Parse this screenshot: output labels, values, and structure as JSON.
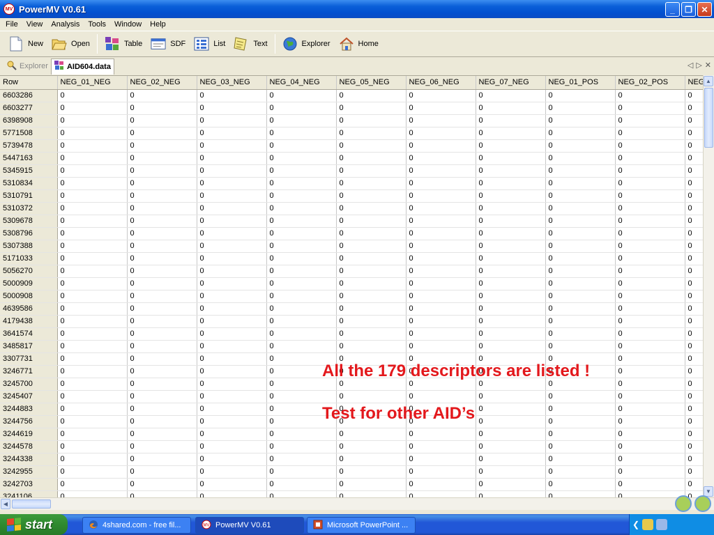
{
  "window": {
    "title": "PowerMV V0.61",
    "icon_label": "MV"
  },
  "menu": [
    "File",
    "View",
    "Analysis",
    "Tools",
    "Window",
    "Help"
  ],
  "toolbar": [
    {
      "label": "New",
      "icon": "new-file-icon"
    },
    {
      "label": "Open",
      "icon": "open-folder-icon"
    },
    {
      "label": "Table",
      "icon": "table-icon"
    },
    {
      "label": "SDF",
      "icon": "sdf-icon"
    },
    {
      "label": "List",
      "icon": "list-icon"
    },
    {
      "label": "Text",
      "icon": "text-icon"
    },
    {
      "label": "Explorer",
      "icon": "globe-icon"
    },
    {
      "label": "Home",
      "icon": "home-icon"
    }
  ],
  "tabs": [
    {
      "label": "Explorer",
      "active": false
    },
    {
      "label": "AID604.data",
      "active": true
    }
  ],
  "grid": {
    "columns": [
      "Row",
      "NEG_01_NEG",
      "NEG_02_NEG",
      "NEG_03_NEG",
      "NEG_04_NEG",
      "NEG_05_NEG",
      "NEG_06_NEG",
      "NEG_07_NEG",
      "NEG_01_POS",
      "NEG_02_POS",
      "NEG_"
    ],
    "rows": [
      {
        "id": "6603286",
        "values": [
          "0",
          "0",
          "0",
          "0",
          "0",
          "0",
          "0",
          "0",
          "0",
          "0"
        ]
      },
      {
        "id": "6603277",
        "values": [
          "0",
          "0",
          "0",
          "0",
          "0",
          "0",
          "0",
          "0",
          "0",
          "0"
        ]
      },
      {
        "id": "6398908",
        "values": [
          "0",
          "0",
          "0",
          "0",
          "0",
          "0",
          "0",
          "0",
          "0",
          "0"
        ]
      },
      {
        "id": "5771508",
        "values": [
          "0",
          "0",
          "0",
          "0",
          "0",
          "0",
          "0",
          "0",
          "0",
          "0"
        ]
      },
      {
        "id": "5739478",
        "values": [
          "0",
          "0",
          "0",
          "0",
          "0",
          "0",
          "0",
          "0",
          "0",
          "0"
        ]
      },
      {
        "id": "5447163",
        "values": [
          "0",
          "0",
          "0",
          "0",
          "0",
          "0",
          "0",
          "0",
          "0",
          "0"
        ]
      },
      {
        "id": "5345915",
        "values": [
          "0",
          "0",
          "0",
          "0",
          "0",
          "0",
          "0",
          "0",
          "0",
          "0"
        ]
      },
      {
        "id": "5310834",
        "values": [
          "0",
          "0",
          "0",
          "0",
          "0",
          "0",
          "0",
          "0",
          "0",
          "0"
        ]
      },
      {
        "id": "5310791",
        "values": [
          "0",
          "0",
          "0",
          "0",
          "0",
          "0",
          "0",
          "0",
          "0",
          "0"
        ]
      },
      {
        "id": "5310372",
        "values": [
          "0",
          "0",
          "0",
          "0",
          "0",
          "0",
          "0",
          "0",
          "0",
          "0"
        ]
      },
      {
        "id": "5309678",
        "values": [
          "0",
          "0",
          "0",
          "0",
          "0",
          "0",
          "0",
          "0",
          "0",
          "0"
        ]
      },
      {
        "id": "5308796",
        "values": [
          "0",
          "0",
          "0",
          "0",
          "0",
          "0",
          "0",
          "0",
          "0",
          "0"
        ]
      },
      {
        "id": "5307388",
        "values": [
          "0",
          "0",
          "0",
          "0",
          "0",
          "0",
          "0",
          "0",
          "0",
          "0"
        ]
      },
      {
        "id": "5171033",
        "values": [
          "0",
          "0",
          "0",
          "0",
          "0",
          "0",
          "0",
          "0",
          "0",
          "0"
        ]
      },
      {
        "id": "5056270",
        "values": [
          "0",
          "0",
          "0",
          "0",
          "0",
          "0",
          "0",
          "0",
          "0",
          "0"
        ]
      },
      {
        "id": "5000909",
        "values": [
          "0",
          "0",
          "0",
          "0",
          "0",
          "0",
          "0",
          "0",
          "0",
          "0"
        ]
      },
      {
        "id": "5000908",
        "values": [
          "0",
          "0",
          "0",
          "0",
          "0",
          "0",
          "0",
          "0",
          "0",
          "0"
        ]
      },
      {
        "id": "4639586",
        "values": [
          "0",
          "0",
          "0",
          "0",
          "0",
          "0",
          "0",
          "0",
          "0",
          "0"
        ]
      },
      {
        "id": "4179438",
        "values": [
          "0",
          "0",
          "0",
          "0",
          "0",
          "0",
          "0",
          "0",
          "0",
          "0"
        ]
      },
      {
        "id": "3641574",
        "values": [
          "0",
          "0",
          "0",
          "0",
          "0",
          "0",
          "0",
          "0",
          "0",
          "0"
        ]
      },
      {
        "id": "3485817",
        "values": [
          "0",
          "0",
          "0",
          "0",
          "0",
          "0",
          "0",
          "0",
          "0",
          "0"
        ]
      },
      {
        "id": "3307731",
        "values": [
          "0",
          "0",
          "0",
          "0",
          "0",
          "0",
          "0",
          "0",
          "0",
          "0"
        ]
      },
      {
        "id": "3246771",
        "values": [
          "0",
          "0",
          "0",
          "0",
          "0",
          "0",
          "0",
          "0",
          "0",
          "0"
        ]
      },
      {
        "id": "3245700",
        "values": [
          "0",
          "0",
          "0",
          "0",
          "0",
          "0",
          "0",
          "0",
          "0",
          "0"
        ]
      },
      {
        "id": "3245407",
        "values": [
          "0",
          "0",
          "0",
          "0",
          "0",
          "0",
          "0",
          "0",
          "0",
          "0"
        ]
      },
      {
        "id": "3244883",
        "values": [
          "0",
          "0",
          "0",
          "0",
          "0",
          "0",
          "0",
          "0",
          "0",
          "0"
        ]
      },
      {
        "id": "3244756",
        "values": [
          "0",
          "0",
          "0",
          "0",
          "0",
          "0",
          "0",
          "0",
          "0",
          "0"
        ]
      },
      {
        "id": "3244619",
        "values": [
          "0",
          "0",
          "0",
          "0",
          "0",
          "0",
          "0",
          "0",
          "0",
          "0"
        ]
      },
      {
        "id": "3244578",
        "values": [
          "0",
          "0",
          "0",
          "0",
          "0",
          "0",
          "0",
          "0",
          "0",
          "0"
        ]
      },
      {
        "id": "3244338",
        "values": [
          "0",
          "0",
          "0",
          "0",
          "0",
          "0",
          "0",
          "0",
          "0",
          "0"
        ]
      },
      {
        "id": "3242955",
        "values": [
          "0",
          "0",
          "0",
          "0",
          "0",
          "0",
          "0",
          "0",
          "0",
          "0"
        ]
      },
      {
        "id": "3242703",
        "values": [
          "0",
          "0",
          "0",
          "0",
          "0",
          "0",
          "0",
          "0",
          "0",
          "0"
        ]
      },
      {
        "id": "3241106",
        "values": [
          "0",
          "0",
          "0",
          "0",
          "0",
          "0",
          "0",
          "0",
          "0",
          "0"
        ]
      }
    ]
  },
  "overlay": {
    "line1": "All the 179 descriptors are listed !",
    "line2": "Test for other AID’s",
    "color": "#e3181c"
  },
  "taskbar": {
    "start_label": "start",
    "tasks": [
      {
        "label": "4shared.com - free fil...",
        "icon": "firefox-icon",
        "active": false
      },
      {
        "label": "PowerMV V0.61",
        "icon": "powermv-icon",
        "active": true
      },
      {
        "label": "Microsoft PowerPoint ...",
        "icon": "powerpoint-icon",
        "active": false
      }
    ]
  }
}
